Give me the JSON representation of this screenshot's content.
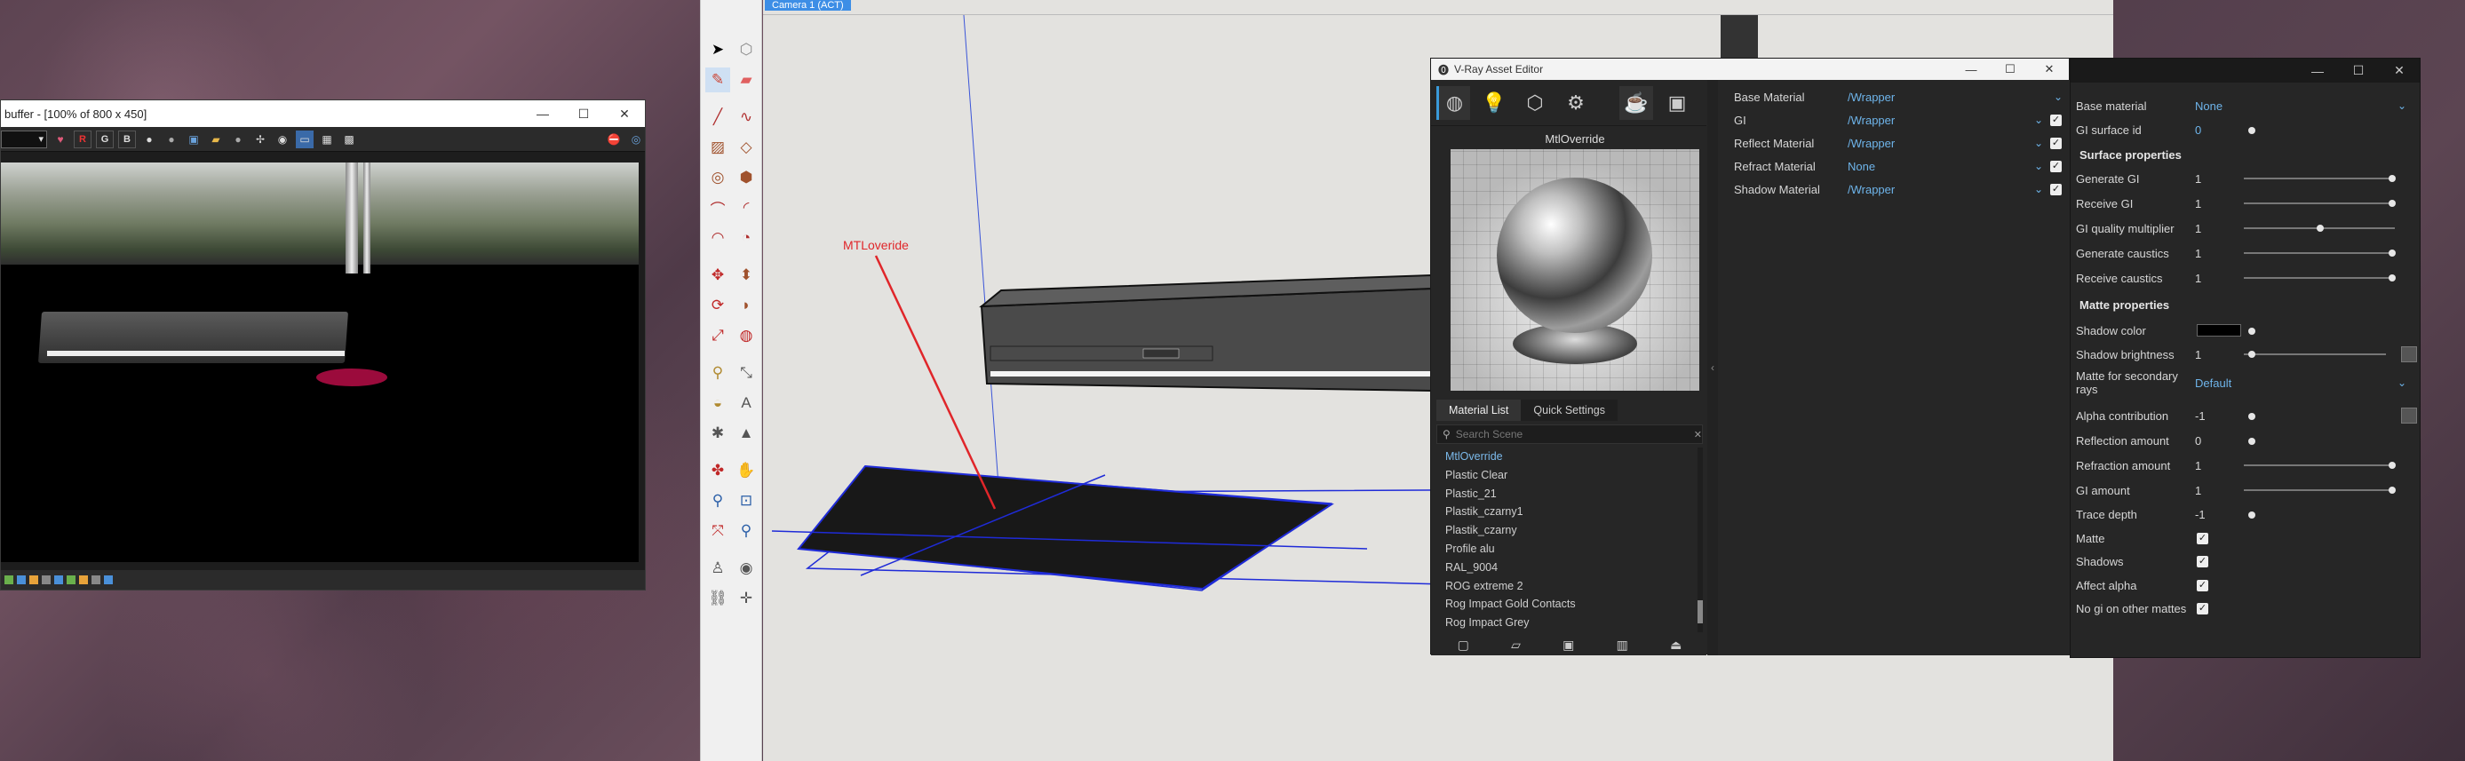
{
  "framebuffer": {
    "title": "buffer - [100% of 800 x 450]",
    "toolbar": {
      "r": "R",
      "g": "G",
      "b": "B"
    },
    "minimize": "—",
    "maximize": "☐",
    "close": "✕"
  },
  "viewport": {
    "scene_tab": "Camera 1 (ACT)",
    "annotation": "MTLoveride"
  },
  "vray_editor": {
    "title": "V-Ray Asset Editor",
    "minimize": "—",
    "maximize": "☐",
    "close": "✕",
    "preview_title": "MtlOverride",
    "tabs": [
      "Material List",
      "Quick Settings"
    ],
    "search_placeholder": "Search Scene",
    "materials": [
      "MtlOverride",
      "Plastic Clear",
      "Plastic_21",
      "Plastik_czarny1",
      "Plastik_czarny",
      "Profile alu",
      "RAL_9004",
      "ROG extreme 2",
      "Rog Impact Gold Contacts",
      "Rog Impact Grey"
    ],
    "active_material": "MtlOverride",
    "props": [
      {
        "label": "Base Material",
        "value": "/Wrapper"
      },
      {
        "label": "GI",
        "value": "/Wrapper"
      },
      {
        "label": "Reflect Material",
        "value": "/Wrapper"
      },
      {
        "label": "Refract Material",
        "value": "None"
      },
      {
        "label": "Shadow Material",
        "value": "/Wrapper"
      }
    ]
  },
  "wrapper_props": {
    "minimize": "—",
    "maximize": "☐",
    "close": "✕",
    "base_material": {
      "label": "Base material",
      "value": "None"
    },
    "gi_surface_id": {
      "label": "GI surface id",
      "value": "0"
    },
    "surface_section": "Surface properties",
    "surface": [
      {
        "label": "Generate GI",
        "value": "1"
      },
      {
        "label": "Receive GI",
        "value": "1"
      },
      {
        "label": "GI quality multiplier",
        "value": "1"
      },
      {
        "label": "Generate caustics",
        "value": "1"
      },
      {
        "label": "Receive caustics",
        "value": "1"
      }
    ],
    "matte_section": "Matte properties",
    "shadow_color": {
      "label": "Shadow color"
    },
    "shadow_brightness": {
      "label": "Shadow brightness",
      "value": "1"
    },
    "matte_secondary": {
      "label": "Matte for secondary rays",
      "value": "Default"
    },
    "matte": [
      {
        "label": "Alpha contribution",
        "value": "-1"
      },
      {
        "label": "Reflection amount",
        "value": "0"
      },
      {
        "label": "Refraction amount",
        "value": "1"
      },
      {
        "label": "GI amount",
        "value": "1"
      },
      {
        "label": "Trace depth",
        "value": "-1"
      }
    ],
    "checks": [
      {
        "label": "Matte",
        "checked": true
      },
      {
        "label": "Shadows",
        "checked": true
      },
      {
        "label": "Affect alpha",
        "checked": true
      },
      {
        "label": "No gi on other mattes",
        "checked": true
      }
    ],
    "gi_quality_level": 0.5,
    "slider_level_full": 1.0
  }
}
